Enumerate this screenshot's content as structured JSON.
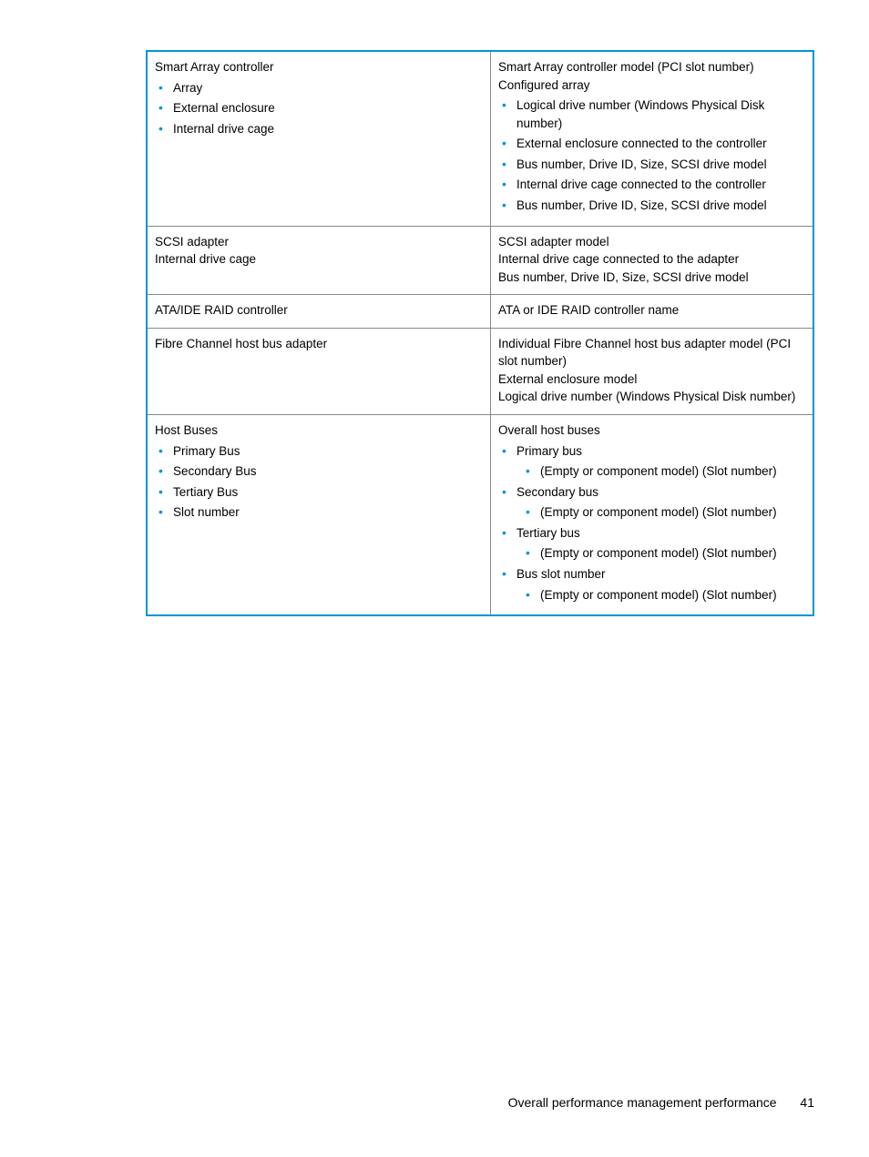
{
  "footer": {
    "title": "Overall performance management performance",
    "page": "41"
  },
  "rows": [
    {
      "l_lead": "Smart Array controller",
      "l_items": [
        "Array",
        "External enclosure",
        "Internal drive cage"
      ],
      "r_lead": [
        "Smart Array controller model (PCI slot number)",
        "Configured array"
      ],
      "r_items": [
        "Logical drive number (Windows Physical Disk number)",
        "External enclosure connected to the controller",
        "Bus number, Drive ID, Size, SCSI drive model",
        "Internal drive cage connected to the controller",
        "Bus number, Drive ID, Size, SCSI drive model"
      ]
    },
    {
      "l_lead": "SCSI adapter",
      "l_lines": [
        "Internal drive cage"
      ],
      "r_lead": [
        "SCSI adapter model",
        "Internal drive cage connected to the adapter",
        "Bus number, Drive ID, Size, SCSI drive model"
      ]
    },
    {
      "l_lead": "ATA/IDE RAID controller",
      "r_lead": [
        "ATA or IDE RAID controller name"
      ]
    },
    {
      "l_lead": "Fibre Channel host bus adapter",
      "r_lead": [
        "Individual Fibre Channel host bus adapter model (PCI slot number)",
        "External enclosure model",
        "Logical drive number (Windows Physical Disk number)"
      ]
    },
    {
      "l_lead": "Host Buses",
      "l_items": [
        "Primary Bus",
        "Secondary Bus",
        "Tertiary Bus",
        "Slot number"
      ],
      "r_lead": [
        "Overall host buses"
      ],
      "r_nested": [
        {
          "t": "Primary bus",
          "s": [
            "(Empty or component model) (Slot number)"
          ]
        },
        {
          "t": "Secondary bus",
          "s": [
            "(Empty or component model) (Slot number)"
          ]
        },
        {
          "t": "Tertiary bus",
          "s": [
            "(Empty or component model) (Slot number)"
          ]
        },
        {
          "t": "Bus slot number",
          "s": [
            "(Empty or component model) (Slot number)"
          ]
        }
      ]
    }
  ]
}
